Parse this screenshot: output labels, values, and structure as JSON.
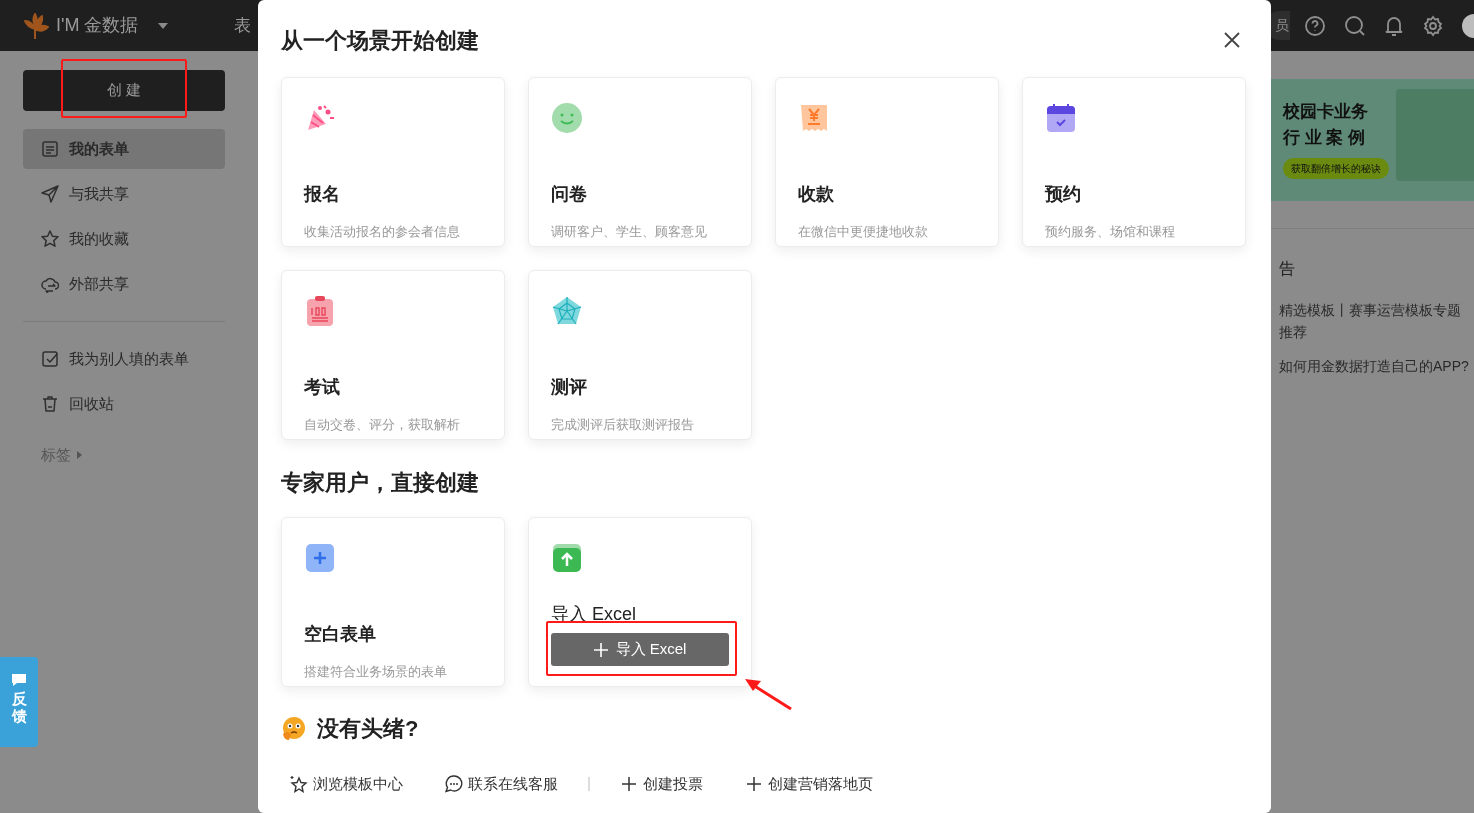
{
  "header": {
    "brand": "I'M 金数据",
    "nav_item": "表",
    "member_pill": "员"
  },
  "sidebar": {
    "create_button": "创 建",
    "groups": [
      {
        "items": [
          {
            "kind": "forms",
            "label": "我的表单",
            "selected": true
          },
          {
            "kind": "shared",
            "label": "与我共享",
            "selected": false
          },
          {
            "kind": "favorites",
            "label": "我的收藏",
            "selected": false
          },
          {
            "kind": "external",
            "label": "外部共享",
            "selected": false
          }
        ]
      },
      {
        "items": [
          {
            "kind": "filled",
            "label": "我为别人填的表单",
            "selected": false
          },
          {
            "kind": "trash",
            "label": "回收站",
            "selected": false
          }
        ]
      }
    ],
    "tags_label": "标签"
  },
  "right_panel": {
    "banner": {
      "lines": [
        "校园卡业务",
        "行 业 案 例"
      ],
      "button": "获取翻倍增长的秘诀"
    },
    "announcements": {
      "title": "告",
      "items": [
        "精选模板丨赛事运营模板专题推荐",
        "如何用金数据打造自己的APP?"
      ]
    }
  },
  "feedback_tab": {
    "label": "反馈"
  },
  "modal": {
    "title": "从一个场景开始创建",
    "scene_cards": [
      {
        "kind": "signup",
        "title": "报名",
        "description": "收集活动报名的参会者信息"
      },
      {
        "kind": "survey",
        "title": "问卷",
        "description": "调研客户、学生、顾客意见"
      },
      {
        "kind": "payment",
        "title": "收款",
        "description": "在微信中更便捷地收款"
      },
      {
        "kind": "booking",
        "title": "预约",
        "description": "预约服务、场馆和课程"
      },
      {
        "kind": "exam",
        "title": "考试",
        "description": "自动交卷、评分，获取解析"
      },
      {
        "kind": "assessment",
        "title": "测评",
        "description": "完成测评后获取测评报告"
      }
    ],
    "expert_title": "专家用户，直接创建",
    "expert_cards": [
      {
        "kind": "blank",
        "title": "空白表单",
        "description": "搭建符合业务场景的表单"
      },
      {
        "kind": "import",
        "title": "导入 Excel",
        "button": "导入 Excel"
      }
    ],
    "help_title": "没有头绪?",
    "help_links": [
      {
        "kind": "templates",
        "label": "浏览模板中心"
      },
      {
        "kind": "chat",
        "label": "联系在线客服"
      },
      {
        "kind": "create",
        "label": "创建投票"
      },
      {
        "kind": "create",
        "label": "创建营销落地页"
      }
    ]
  }
}
